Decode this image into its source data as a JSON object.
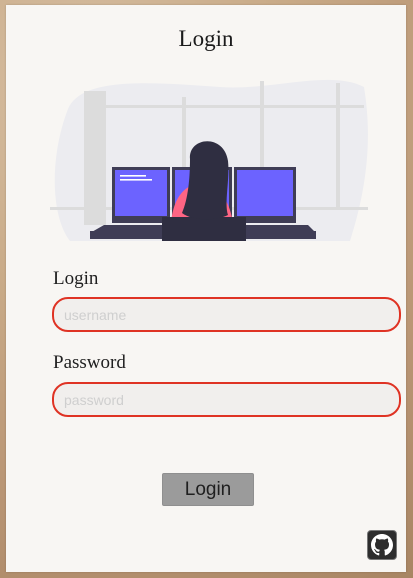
{
  "form": {
    "title": "Login",
    "login_label": "Login",
    "username_placeholder": "username",
    "password_label": "Password",
    "password_placeholder": "password",
    "submit_label": "Login"
  },
  "icons": {
    "illustration": "person-at-computer-illustration",
    "github": "github-icon"
  },
  "colors": {
    "field_border": "#df3324",
    "monitor": "#6c63ff",
    "shirt": "#ff6584",
    "button": "#9b9b9b"
  }
}
